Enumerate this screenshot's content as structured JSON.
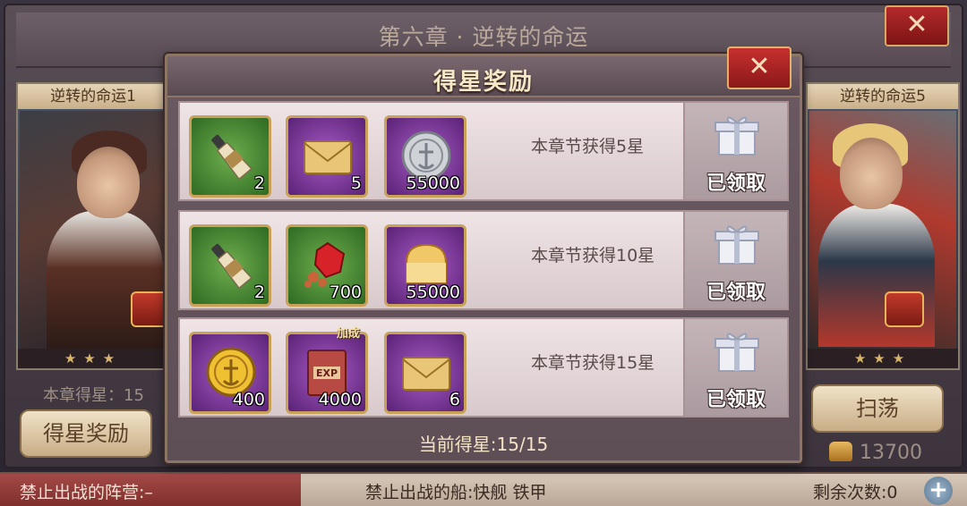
{
  "background": {
    "chapter_title": "第六章 · 逆转的命运",
    "chapter_subtitle": "逆转的命运1",
    "close_label": "✕",
    "left_card_label": "逆转的命运1",
    "right_card_label": "逆转的命运5",
    "card_stars": "★★★",
    "chapter_stars_text": "本章得星：15",
    "star_reward_button": "得星奖励",
    "sweep_button": "扫荡",
    "bread_count": "13700",
    "bottom_bar": {
      "banned_camp": "禁止出战的阵营:–",
      "banned_ships": "禁止出战的船:快舰 铁甲",
      "remaining": "剩余次数:0",
      "add_label": "+"
    }
  },
  "dialog": {
    "title": "得星奖励",
    "close_label": "✕",
    "rows": [
      {
        "requirement": "本章节获得5星",
        "status": "已领取",
        "items": [
          {
            "icon": "champagne-bottle-icon",
            "frame": "green",
            "qty": "2"
          },
          {
            "icon": "envelope-icon",
            "frame": "purple",
            "qty": "5"
          },
          {
            "icon": "silver-coin-icon",
            "frame": "purple",
            "qty": "55000"
          }
        ]
      },
      {
        "requirement": "本章节获得10星",
        "status": "已领取",
        "items": [
          {
            "icon": "champagne-bottle-icon",
            "frame": "green",
            "qty": "2"
          },
          {
            "icon": "red-gem-icon",
            "frame": "green",
            "qty": "700"
          },
          {
            "icon": "bread-icon",
            "frame": "purple",
            "qty": "55000"
          }
        ]
      },
      {
        "requirement": "本章节获得15星",
        "status": "已领取",
        "items": [
          {
            "icon": "gold-coin-icon",
            "frame": "purple",
            "qty": "400"
          },
          {
            "icon": "exp-book-icon",
            "frame": "purple",
            "qty": "4000",
            "bonus": "加成"
          },
          {
            "icon": "envelope-icon",
            "frame": "purple",
            "qty": "6"
          }
        ]
      }
    ],
    "current_stars": "当前得星:15/15"
  }
}
